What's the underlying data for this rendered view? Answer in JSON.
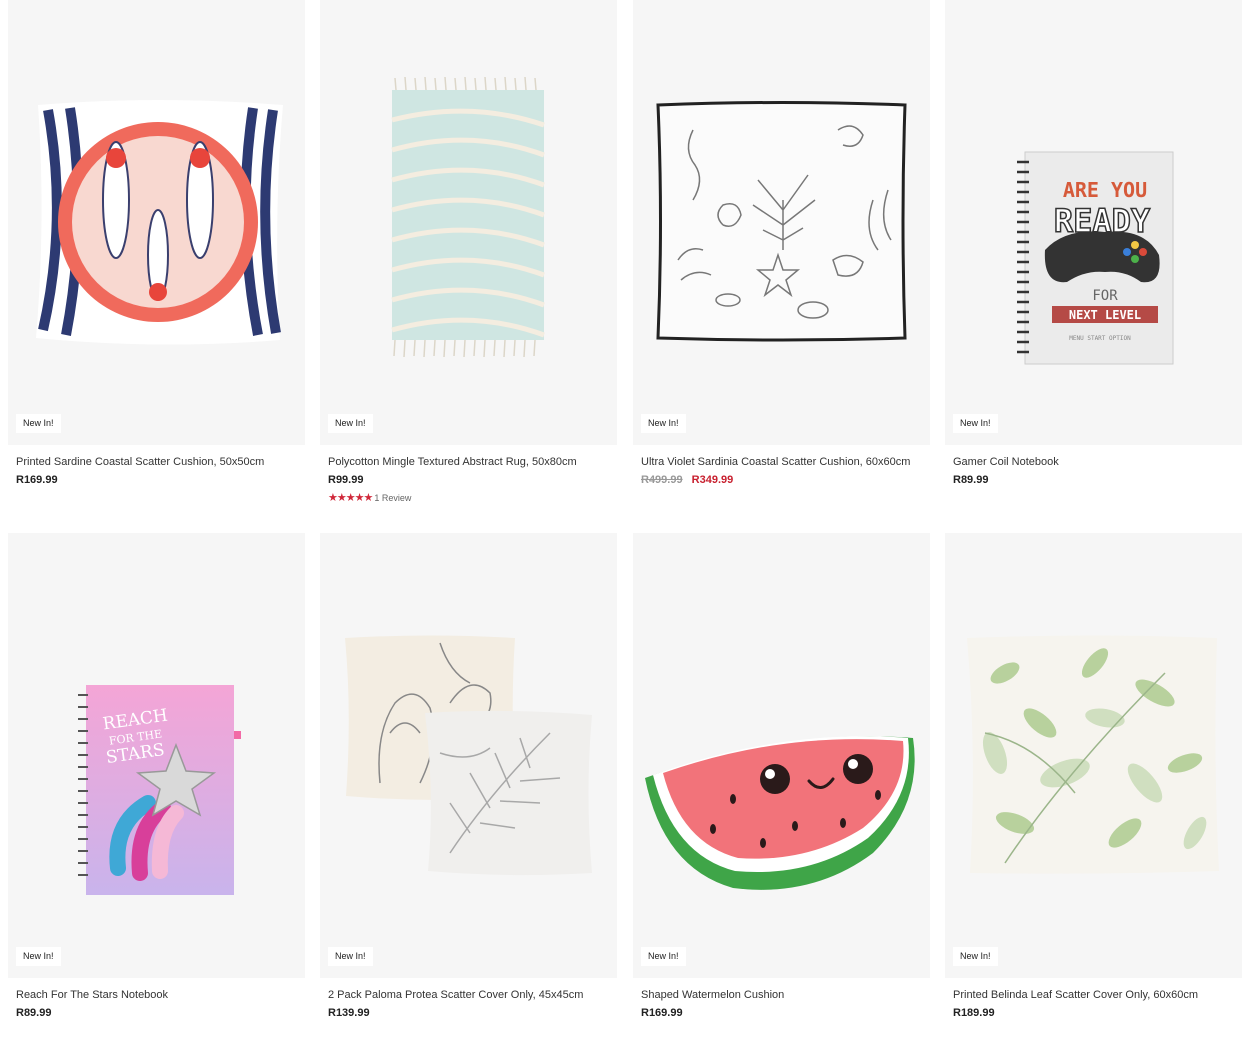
{
  "products": [
    {
      "title": "Printed Sardine Coastal Scatter Cushion, 50x50cm",
      "price": "R169.99",
      "badge": "New In!"
    },
    {
      "title": "Polycotton Mingle Textured Abstract Rug, 50x80cm",
      "price": "R99.99",
      "badge": "New In!",
      "rating_stars": "★★★★★",
      "rating_text": "1 Review",
      "rating_value": 5
    },
    {
      "title": "Ultra Violet Sardinia Coastal Scatter Cushion, 60x60cm",
      "price_old": "R499.99",
      "price_sale": "R349.99",
      "badge": "New In!"
    },
    {
      "title": "Gamer Coil Notebook",
      "price": "R89.99",
      "badge": "New In!"
    },
    {
      "title": "Reach For The Stars Notebook",
      "price": "R89.99",
      "badge": "New In!"
    },
    {
      "title": "2 Pack Paloma Protea Scatter Cover Only, 45x45cm",
      "price": "R139.99",
      "badge": "New In!"
    },
    {
      "title": "Shaped Watermelon Cushion",
      "price": "R169.99",
      "badge": "New In!"
    },
    {
      "title": "Printed Belinda Leaf Scatter Cover Only, 60x60cm",
      "price": "R189.99",
      "badge": "New In!"
    }
  ],
  "image_text": {
    "gamer_line1": "ARE YOU",
    "gamer_line2": "READY",
    "gamer_line3": "FOR",
    "gamer_line4": "NEXT LEVEL",
    "gamer_line5": "MENU START OPTION",
    "stars_line1": "REACH",
    "stars_line2": "FOR THE",
    "stars_line3": "STARS"
  },
  "colors": {
    "sale": "#c8202f",
    "star": "#d0283a",
    "image_bg": "#f6f6f6"
  }
}
